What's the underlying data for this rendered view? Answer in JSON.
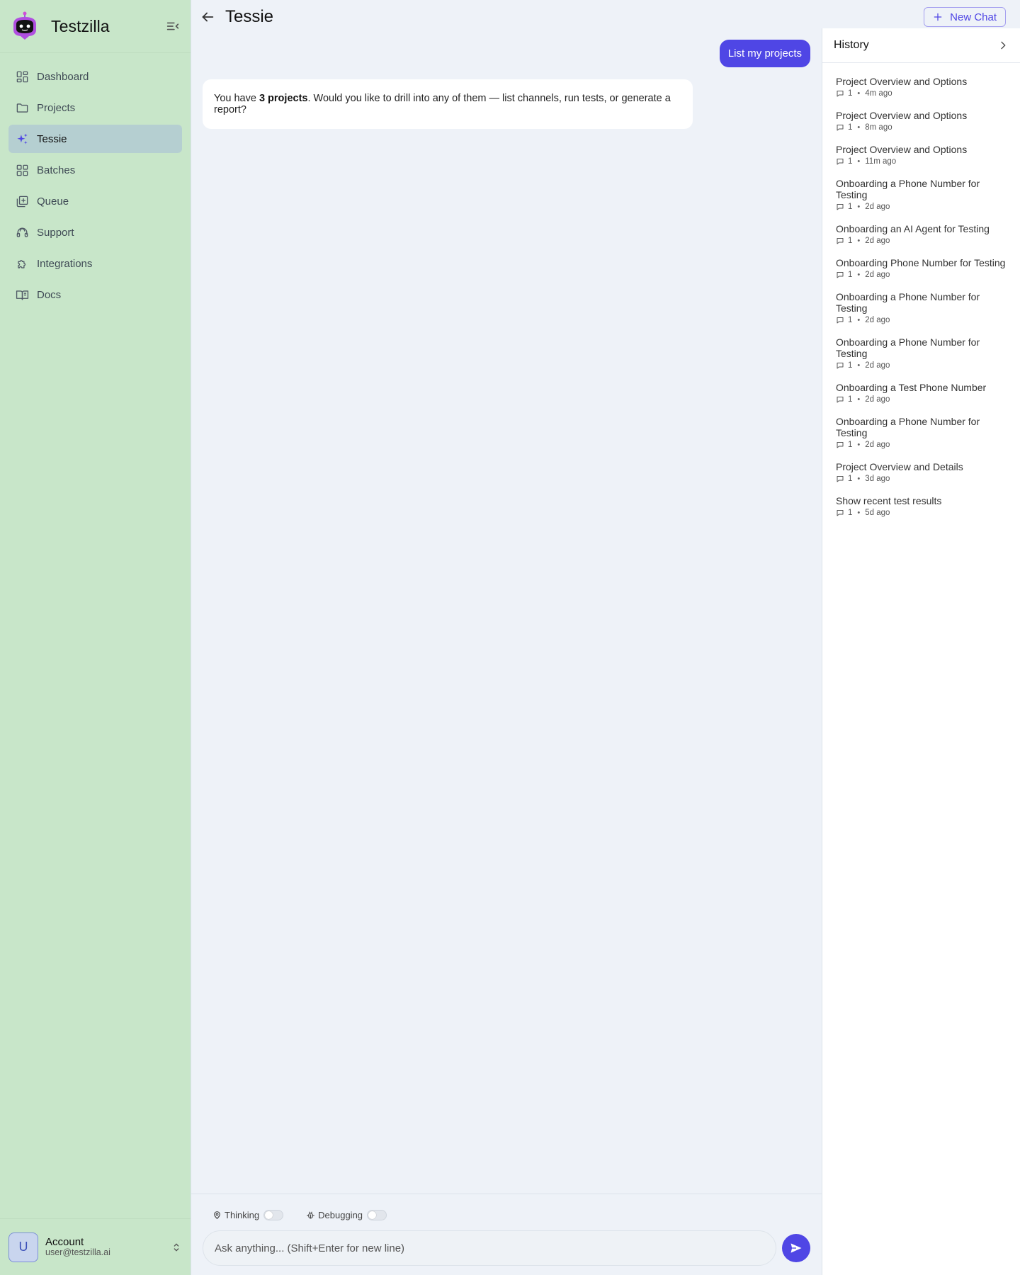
{
  "app": {
    "name": "Testzilla"
  },
  "sidebar": {
    "items": [
      {
        "label": "Dashboard",
        "icon": "dashboard-icon"
      },
      {
        "label": "Projects",
        "icon": "folder-icon"
      },
      {
        "label": "Tessie",
        "icon": "sparkles-icon",
        "active": true
      },
      {
        "label": "Batches",
        "icon": "grid-icon"
      },
      {
        "label": "Queue",
        "icon": "queue-icon"
      },
      {
        "label": "Support",
        "icon": "headset-icon"
      },
      {
        "label": "Integrations",
        "icon": "puzzle-icon"
      },
      {
        "label": "Docs",
        "icon": "book-icon"
      }
    ],
    "account": {
      "initial": "U",
      "label": "Account",
      "email": "user@testzilla.ai"
    }
  },
  "header": {
    "title": "Tessie",
    "new_chat_label": "New Chat"
  },
  "chat": {
    "user_message": "List my projects",
    "bot_message": {
      "before": "You have ",
      "bold": "3 projects",
      "after": ". Would you like to drill into any of them — list channels, run tests, or generate a report?"
    }
  },
  "composer": {
    "thinking_label": "Thinking",
    "debugging_label": "Debugging",
    "placeholder": "Ask anything... (Shift+Enter for new line)"
  },
  "history": {
    "title": "History",
    "items": [
      {
        "title": "Project Overview and Options",
        "count": "1",
        "time": "4m ago"
      },
      {
        "title": "Project Overview and Options",
        "count": "1",
        "time": "8m ago"
      },
      {
        "title": "Project Overview and Options",
        "count": "1",
        "time": "11m ago"
      },
      {
        "title": "Onboarding a Phone Number for Testing",
        "count": "1",
        "time": "2d ago"
      },
      {
        "title": "Onboarding an AI Agent for Testing",
        "count": "1",
        "time": "2d ago"
      },
      {
        "title": "Onboarding Phone Number for Testing",
        "count": "1",
        "time": "2d ago"
      },
      {
        "title": "Onboarding a Phone Number for Testing",
        "count": "1",
        "time": "2d ago"
      },
      {
        "title": "Onboarding a Phone Number for Testing",
        "count": "1",
        "time": "2d ago"
      },
      {
        "title": "Onboarding a Test Phone Number",
        "count": "1",
        "time": "2d ago"
      },
      {
        "title": "Onboarding a Phone Number for Testing",
        "count": "1",
        "time": "2d ago"
      },
      {
        "title": "Project Overview and Details",
        "count": "1",
        "time": "3d ago"
      },
      {
        "title": "Show recent test results",
        "count": "1",
        "time": "5d ago"
      }
    ]
  },
  "colors": {
    "sidebar_bg": "#c8e6c9",
    "accent": "#4f46e5",
    "main_bg": "#eef2f8"
  }
}
